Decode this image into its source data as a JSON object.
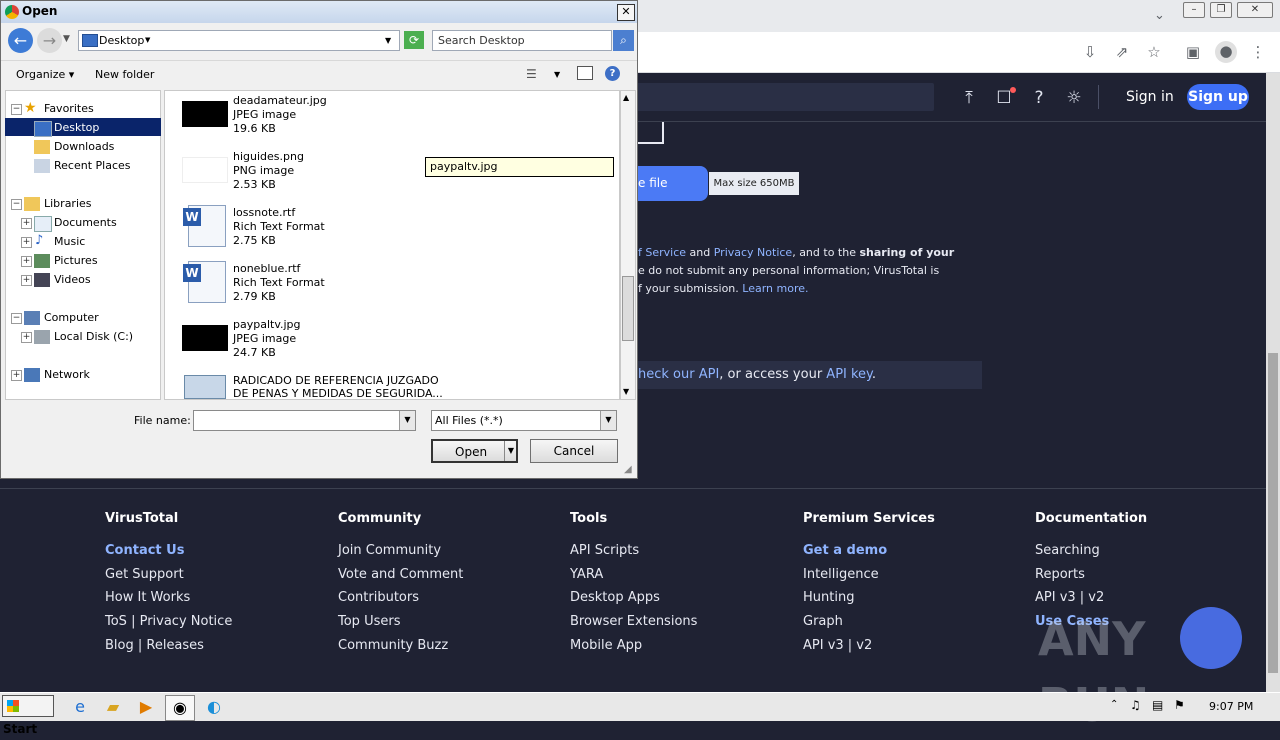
{
  "browser": {
    "right_controls": {
      "minimize": "▭",
      "restore": "▢",
      "close": "✕"
    },
    "toolbar_icons": [
      "download-icon",
      "share-icon",
      "star-icon",
      "sidebar-icon",
      "profile-icon",
      "menu-icon"
    ]
  },
  "vt_header": {
    "signin": "Sign in",
    "signup": "Sign up"
  },
  "vt_main": {
    "choose_file_tail": "e file",
    "max_size": "Max size 650MB",
    "terms_line1_parts": [
      "f Service",
      " and ",
      "Privacy Notice",
      ", and to the ",
      "sharing of your"
    ],
    "terms_line2": "e do not submit any personal information; VirusTotal is",
    "terms_line3_text": "f your submission. ",
    "terms_line3_link": "Learn more.",
    "api_line_parts": [
      "heck our API",
      ", or access your ",
      "API key",
      "."
    ]
  },
  "footer": {
    "columns": [
      {
        "heading": "VirusTotal",
        "items": [
          "Contact Us",
          "Get Support",
          "How It Works",
          "ToS | Privacy Notice",
          "Blog | Releases"
        ]
      },
      {
        "heading": "Community",
        "items": [
          "Join Community",
          "Vote and Comment",
          "Contributors",
          "Top Users",
          "Community Buzz"
        ]
      },
      {
        "heading": "Tools",
        "items": [
          "API Scripts",
          "YARA",
          "Desktop Apps",
          "Browser Extensions",
          "Mobile App"
        ]
      },
      {
        "heading": "Premium Services",
        "items": [
          "Get a demo",
          "Intelligence",
          "Hunting",
          "Graph",
          "API v3 | v2"
        ]
      },
      {
        "heading": "Documentation",
        "items": [
          "Searching",
          "Reports",
          "API v3 | v2",
          "Use Cases"
        ]
      }
    ],
    "watermark": "ANY RUN"
  },
  "dialog": {
    "title": "Open",
    "address": "Desktop",
    "search_placeholder": "Search Desktop",
    "organize": "Organize",
    "new_folder": "New folder",
    "nav": {
      "favorites": "Favorites",
      "desktop": "Desktop",
      "downloads": "Downloads",
      "recent": "Recent Places",
      "libraries": "Libraries",
      "documents": "Documents",
      "music": "Music",
      "pictures": "Pictures",
      "videos": "Videos",
      "computer": "Computer",
      "local_disk": "Local Disk (C:)",
      "network": "Network"
    },
    "files": [
      {
        "name": "deadamateur.jpg",
        "type": "JPEG image",
        "size": "19.6 KB"
      },
      {
        "name": "higuides.png",
        "type": "PNG image",
        "size": "2.53 KB"
      },
      {
        "name": "lossnote.rtf",
        "type": "Rich Text Format",
        "size": "2.75 KB"
      },
      {
        "name": "noneblue.rtf",
        "type": "Rich Text Format",
        "size": "2.79 KB"
      },
      {
        "name": "paypaltv.jpg",
        "type": "JPEG image",
        "size": "24.7 KB"
      },
      {
        "name": "RADICADO DE REFERENCIA JUZGADO",
        "name2": "DE PENAS Y MEDIDAS DE SEGURIDA..."
      }
    ],
    "tooltip": "paypaltv.jpg",
    "file_name_label": "File name:",
    "file_name_value": "",
    "filter": "All Files (*.*)",
    "open": "Open",
    "cancel": "Cancel"
  },
  "taskbar": {
    "start": "Start",
    "clock": "9:07 PM"
  }
}
